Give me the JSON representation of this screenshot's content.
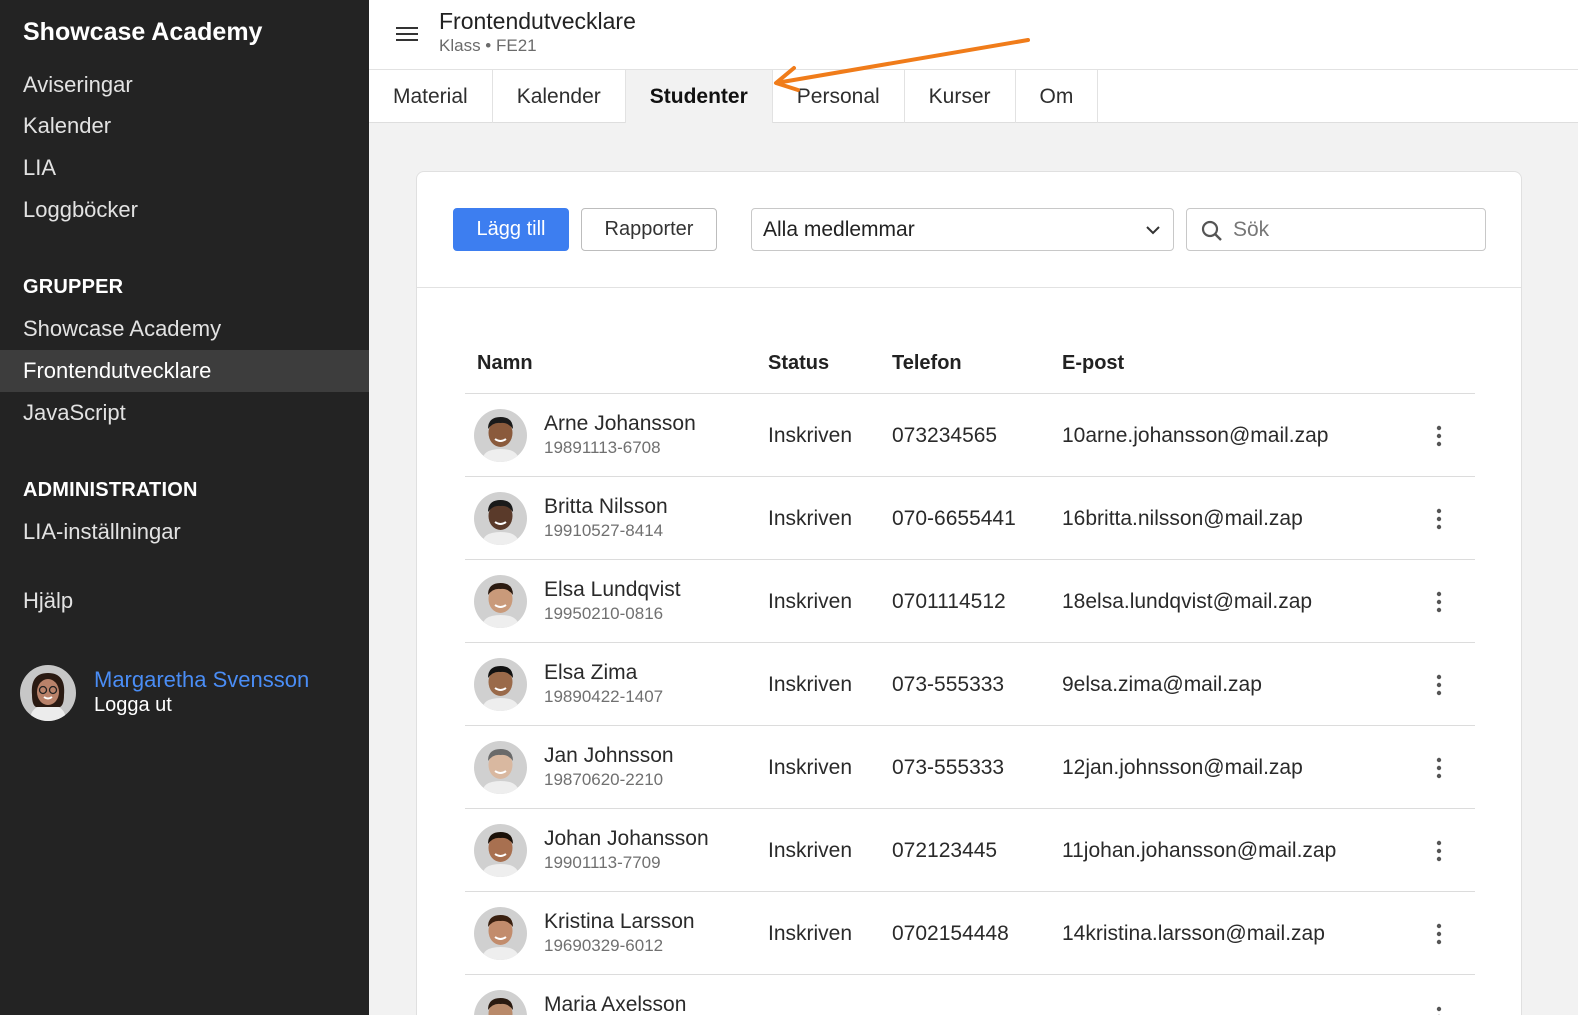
{
  "sidebar": {
    "brand": "Showcase Academy",
    "nav": [
      "Aviseringar",
      "Kalender",
      "LIA",
      "Loggböcker"
    ],
    "groups_heading": "GRUPPER",
    "groups": [
      "Showcase Academy",
      "Frontendutvecklare",
      "JavaScript"
    ],
    "active_group": "Frontendutvecklare",
    "admin_heading": "ADMINISTRATION",
    "admin_items": [
      "LIA-inställningar"
    ],
    "help": "Hjälp",
    "user": {
      "name": "Margaretha Svensson",
      "logout": "Logga ut"
    }
  },
  "header": {
    "title": "Frontendutvecklare",
    "breadcrumb": "Klass • FE21"
  },
  "tabs": [
    {
      "label": "Material"
    },
    {
      "label": "Kalender"
    },
    {
      "label": "Studenter",
      "active": true
    },
    {
      "label": "Personal"
    },
    {
      "label": "Kurser"
    },
    {
      "label": "Om"
    }
  ],
  "toolbar": {
    "add_label": "Lägg till",
    "reports_label": "Rapporter",
    "filter_value": "Alla medlemmar",
    "search_placeholder": "Sök"
  },
  "table": {
    "columns": {
      "name": "Namn",
      "status": "Status",
      "phone": "Telefon",
      "email": "E-post"
    },
    "rows": [
      {
        "name": "Arne Johansson",
        "pnr": "19891113-6708",
        "status": "Inskriven",
        "phone": "073234565",
        "email": "10arne.johansson@mail.zap"
      },
      {
        "name": "Britta Nilsson",
        "pnr": "19910527-8414",
        "status": "Inskriven",
        "phone": "070-6655441",
        "email": "16britta.nilsson@mail.zap"
      },
      {
        "name": "Elsa Lundqvist",
        "pnr": "19950210-0816",
        "status": "Inskriven",
        "phone": "0701114512",
        "email": "18elsa.lundqvist@mail.zap"
      },
      {
        "name": "Elsa Zima",
        "pnr": "19890422-1407",
        "status": "Inskriven",
        "phone": "073-555333",
        "email": "9elsa.zima@mail.zap"
      },
      {
        "name": "Jan Johnsson",
        "pnr": "19870620-2210",
        "status": "Inskriven",
        "phone": "073-555333",
        "email": "12jan.johnsson@mail.zap"
      },
      {
        "name": "Johan Johansson",
        "pnr": "19901113-7709",
        "status": "Inskriven",
        "phone": "072123445",
        "email": "11johan.johansson@mail.zap"
      },
      {
        "name": "Kristina Larsson",
        "pnr": "19690329-6012",
        "status": "Inskriven",
        "phone": "0702154448",
        "email": "14kristina.larsson@mail.zap"
      },
      {
        "name": "Maria Axelsson",
        "pnr": "",
        "status": "",
        "phone": "",
        "email": ""
      }
    ]
  },
  "colors": {
    "sidebar_bg": "#232323",
    "accent": "#3d7ef0",
    "link": "#4a8df5",
    "annotation_arrow": "#f07c1a"
  }
}
